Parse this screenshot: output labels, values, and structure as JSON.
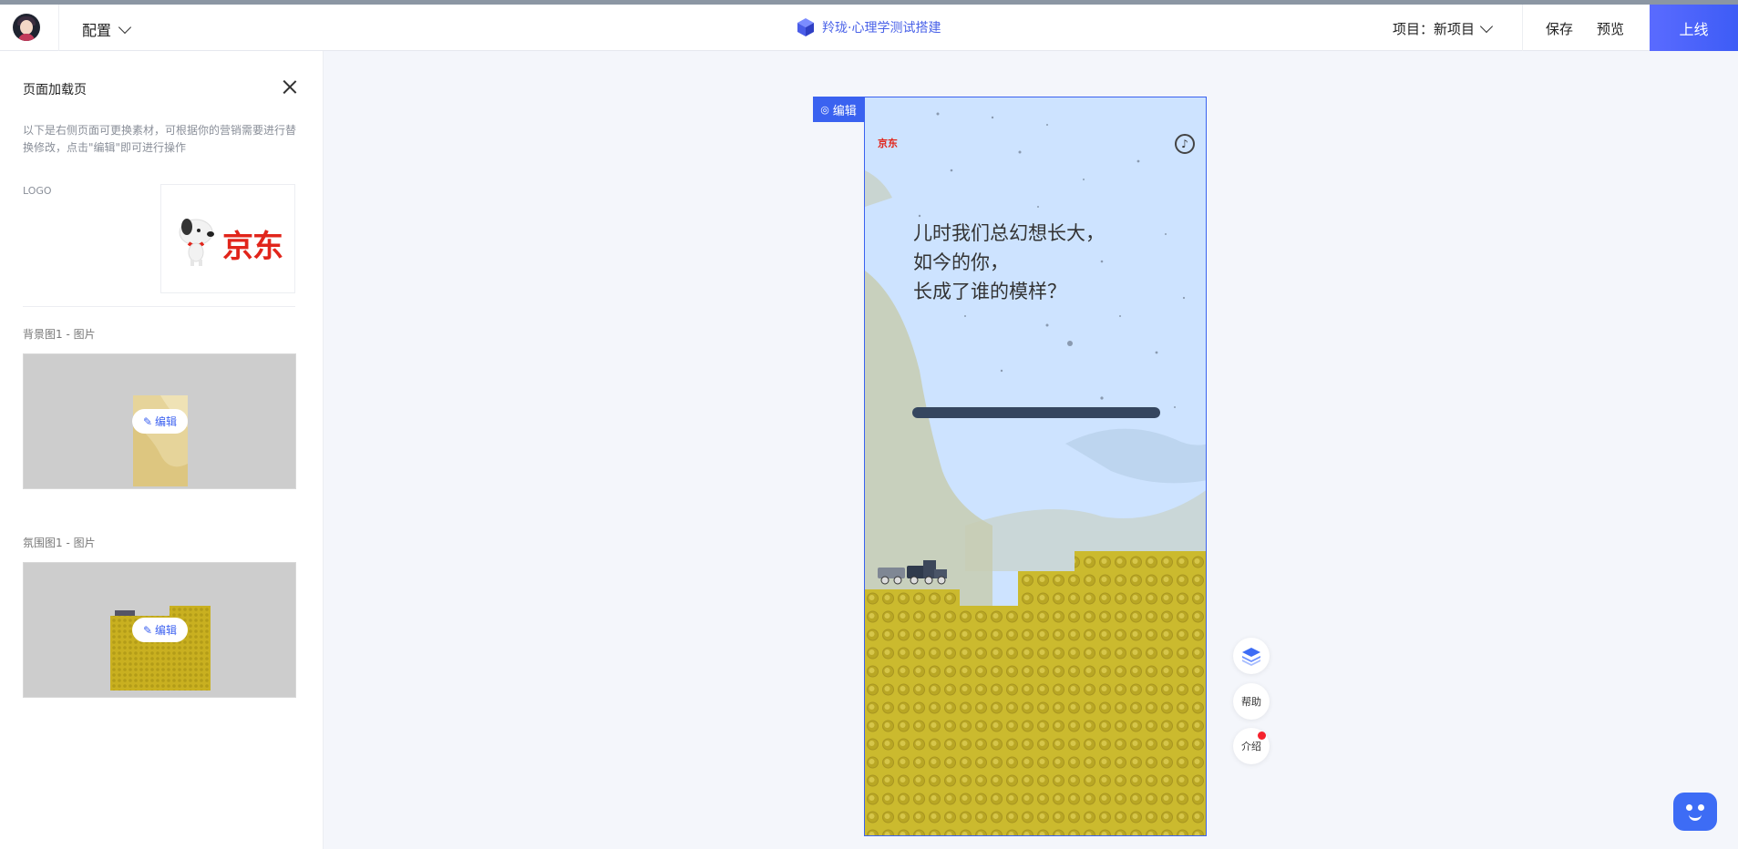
{
  "header": {
    "config_label": "配置",
    "brand_name": "羚珑·心理学测试搭建",
    "project_label": "项目：新项目",
    "save_label": "保存",
    "preview_label": "预览",
    "online_label": "上线"
  },
  "panel": {
    "title": "页面加载页",
    "description": "以下是右侧页面可更换素材，可根据你的营销需要进行替换修改，点击\"编辑\"即可进行操作",
    "logo_label": "LOGO",
    "logo_text": "京东",
    "sections": [
      {
        "label": "背景图1 - 图片",
        "edit_label": "编辑"
      },
      {
        "label": "氛围图1 - 图片",
        "edit_label": "编辑"
      }
    ]
  },
  "canvas": {
    "edit_tag": "编辑",
    "phone_logo": "京东",
    "lines": [
      "儿时我们总幻想长大，",
      "如今的你，",
      "长成了谁的模样？"
    ]
  },
  "tools": {
    "help_label": "帮助",
    "intro_label": "介绍"
  },
  "colors": {
    "accent": "#3a62f0",
    "brick": "#c9b832",
    "sky": "#cde3ff",
    "jd_red": "#e1251b"
  }
}
